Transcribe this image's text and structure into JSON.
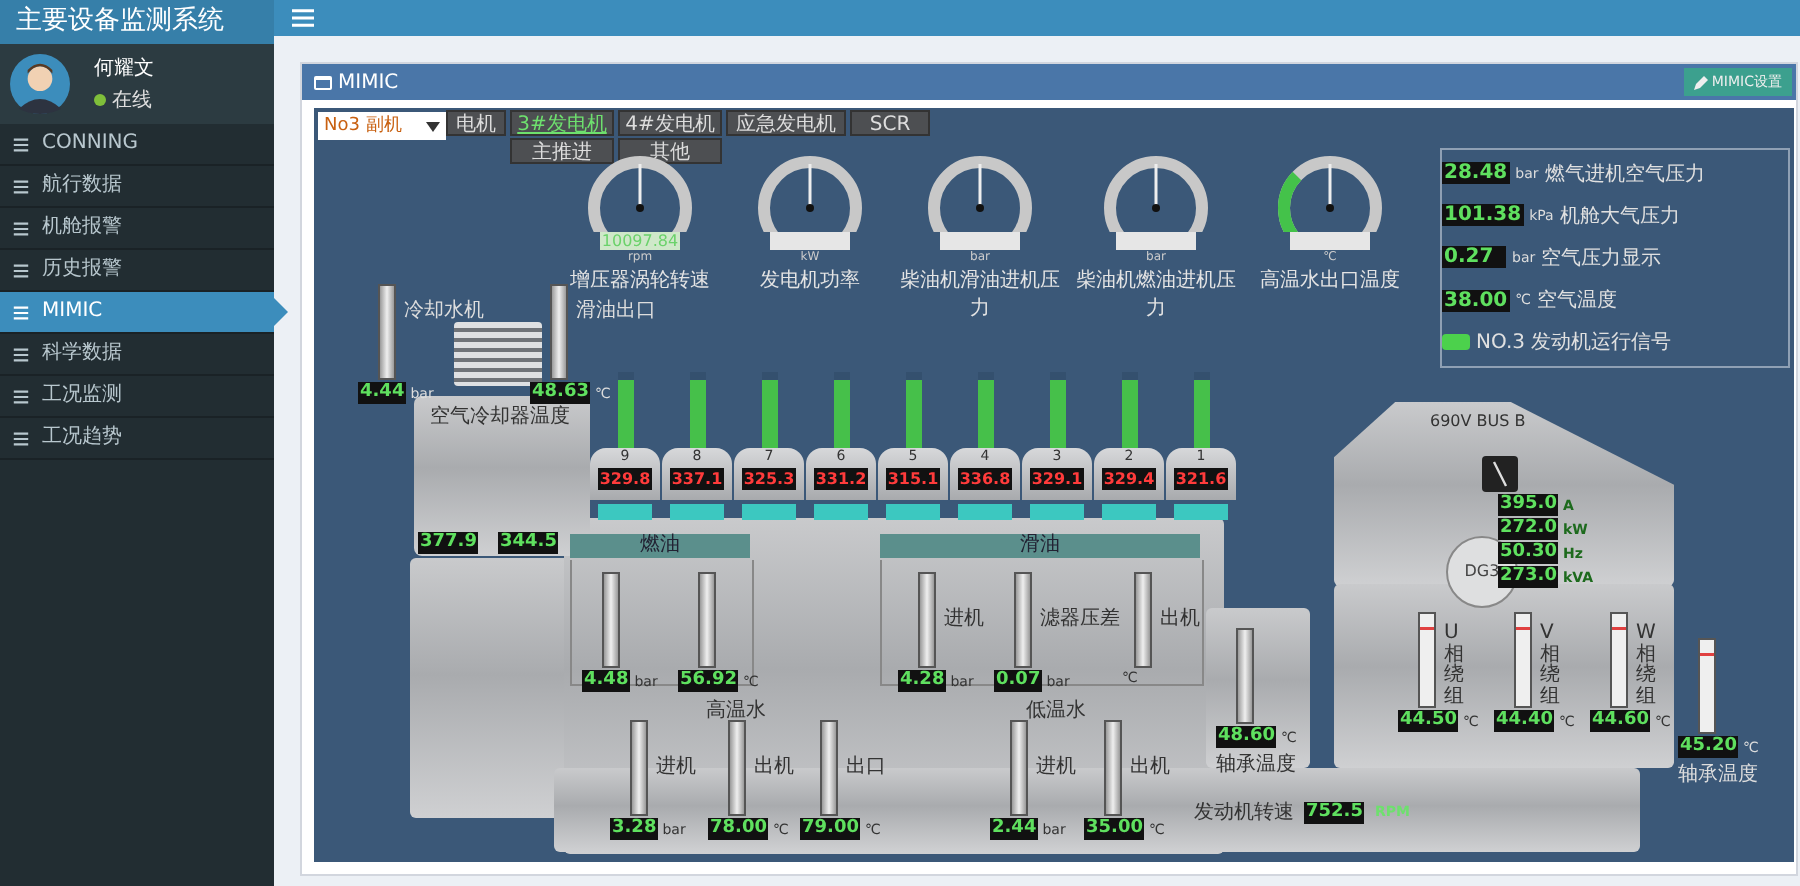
{
  "app_title": "主要设备监测系统",
  "user": {
    "name": "何耀文",
    "status": "在线"
  },
  "menu": [
    {
      "label": "CONNING",
      "selected": false
    },
    {
      "label": "航行数据",
      "selected": false
    },
    {
      "label": "机舱报警",
      "selected": false
    },
    {
      "label": "历史报警",
      "selected": false
    },
    {
      "label": "MIMIC",
      "selected": true
    },
    {
      "label": "科学数据",
      "selected": false
    },
    {
      "label": "工况监测",
      "selected": false
    },
    {
      "label": "工况趋势",
      "selected": false
    }
  ],
  "panel": {
    "title": "MIMIC",
    "settings_button": "MIMIC设置"
  },
  "unit_select": {
    "value": "No3 副机"
  },
  "tabs": [
    {
      "label": "电机",
      "selected": false
    },
    {
      "label": "3#发电机",
      "selected": true
    },
    {
      "label": "4#发电机",
      "selected": false
    },
    {
      "label": "应急发电机",
      "selected": false
    },
    {
      "label": "SCR",
      "selected": false
    },
    {
      "label": "主推进",
      "selected": false
    },
    {
      "label": "其他",
      "selected": false
    }
  ],
  "gauges": [
    {
      "label": "增压器涡轮转速",
      "unit": "rpm",
      "value": "10097.84"
    },
    {
      "label": "发电机功率",
      "unit": "kW"
    },
    {
      "label": "柴油机滑油进机压力",
      "unit": "bar"
    },
    {
      "label": "柴油机燃油进机压力",
      "unit": "bar"
    },
    {
      "label": "高温水出口温度",
      "unit": "℃",
      "green_zone": true
    }
  ],
  "readings_box": {
    "rows": [
      {
        "value": "28.48",
        "unit": "bar",
        "label": "燃气进机空气压力"
      },
      {
        "value": "101.38",
        "unit": "kPa",
        "label": "机舱大气压力"
      },
      {
        "value": "0.27",
        "unit": "bar",
        "label": "空气压力显示"
      },
      {
        "value": "38.00",
        "unit": "℃",
        "label": "空气温度"
      }
    ],
    "run_signal": {
      "label": "NO.3 发动机运行信号",
      "on": true
    }
  },
  "left_bars": [
    {
      "label": "冷却水机",
      "value": "4.44",
      "unit": "bar"
    },
    {
      "label": "滑油出口",
      "value": "48.63",
      "unit": "℃"
    }
  ],
  "cooler": {
    "label": "空气冷却器温度",
    "values": [
      "377.9",
      "344.5"
    ]
  },
  "cylinders": [
    {
      "number": "9",
      "temp": "329.8",
      "level": 0.9
    },
    {
      "number": "8",
      "temp": "337.1",
      "level": 0.9
    },
    {
      "number": "7",
      "temp": "325.3",
      "level": 0.9
    },
    {
      "number": "6",
      "temp": "331.2",
      "level": 0.9
    },
    {
      "number": "5",
      "temp": "315.1",
      "level": 0.9
    },
    {
      "number": "4",
      "temp": "336.8",
      "level": 0.9
    },
    {
      "number": "3",
      "temp": "329.1",
      "level": 0.9
    },
    {
      "number": "2",
      "temp": "329.4",
      "level": 0.9
    },
    {
      "number": "1",
      "temp": "321.6",
      "level": 0.9
    }
  ],
  "fuel": {
    "title": "燃油",
    "bars": [
      {
        "value": "4.48",
        "unit": "bar"
      },
      {
        "value": "56.92",
        "unit": "℃"
      }
    ]
  },
  "lube": {
    "title": "滑油",
    "bars": [
      {
        "label": "进机",
        "value": "4.28",
        "unit": "bar"
      },
      {
        "label": "滤器压差",
        "value": "0.07",
        "unit": "bar"
      },
      {
        "label": "出机",
        "unit": "℃"
      }
    ]
  },
  "ht_water": {
    "title": "高温水",
    "bars": [
      {
        "label": "进机",
        "value": "3.28",
        "unit": "bar"
      },
      {
        "label": "出机",
        "value": "78.00",
        "unit": "℃"
      },
      {
        "label": "出口",
        "value": "79.00",
        "unit": "℃"
      }
    ]
  },
  "lt_water": {
    "title": "低温水",
    "bars": [
      {
        "label": "进机",
        "value": "2.44",
        "unit": "bar"
      },
      {
        "label": "出机",
        "value": "35.00",
        "unit": "℃"
      }
    ]
  },
  "bearing_front": {
    "label": "轴承温度",
    "value": "48.60",
    "unit": "℃"
  },
  "bus": {
    "label": "690V BUS B"
  },
  "generator": {
    "label": "DG3",
    "readings": [
      {
        "value": "395.0",
        "unit": "A"
      },
      {
        "value": "272.0",
        "unit": "kW"
      },
      {
        "value": "50.30",
        "unit": "Hz"
      },
      {
        "value": "273.0",
        "unit": "kVA"
      }
    ]
  },
  "windings": [
    {
      "label": "U相绕组",
      "value": "44.50",
      "unit": "℃"
    },
    {
      "label": "V相绕组",
      "value": "44.40",
      "unit": "℃"
    },
    {
      "label": "W相绕组",
      "value": "44.60",
      "unit": "℃"
    }
  ],
  "bearing_rear": {
    "label": "轴承温度",
    "value": "45.20",
    "unit": "℃"
  },
  "speed": {
    "label": "发动机转速",
    "value": "752.5",
    "unit": "RPM"
  }
}
